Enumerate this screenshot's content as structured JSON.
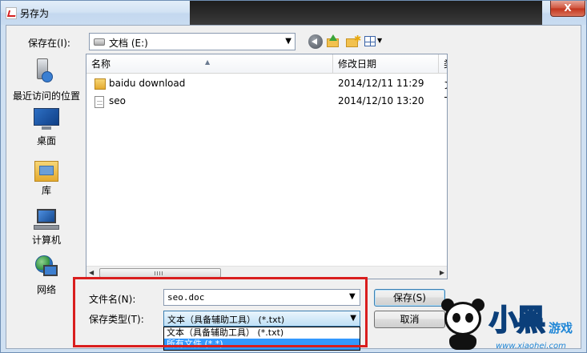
{
  "window": {
    "title": "另存为",
    "close_glyph": "X"
  },
  "toolbar": {
    "save_in_label": "保存在(I):",
    "save_in_value": "文档  (E:)",
    "back_icon": "back-arrow-icon",
    "up_icon": "up-folder-icon",
    "new_folder_icon": "new-folder-icon",
    "views_icon": "views-menu-icon"
  },
  "places": [
    {
      "label": "最近访问的位置",
      "icon": "recent-places-icon"
    },
    {
      "label": "桌面",
      "icon": "desktop-icon"
    },
    {
      "label": "库",
      "icon": "libraries-icon"
    },
    {
      "label": "计算机",
      "icon": "computer-icon"
    },
    {
      "label": "网络",
      "icon": "network-icon"
    }
  ],
  "filelist": {
    "columns": [
      "名称",
      "修改日期",
      "类"
    ],
    "rows": [
      {
        "name": "baidu download",
        "date": "2014/12/11 11:29",
        "extra": "文",
        "type": "folder"
      },
      {
        "name": "seo",
        "date": "2014/12/10 13:20",
        "extra": "T",
        "type": "document"
      }
    ]
  },
  "form": {
    "filename_label": "文件名(N):",
    "filename_value": "seo.doc",
    "filetype_label": "保存类型(T):",
    "filetype_value": "文本（具备辅助工具） (*.txt)",
    "filetype_options": [
      "文本（具备辅助工具） (*.txt)",
      "所有文件 (*.*)"
    ],
    "save_button": "保存(S)",
    "cancel_button": "取消"
  },
  "watermark": {
    "title": "小黑",
    "sub": "游戏",
    "url": "www.xiaohei.com"
  },
  "colors": {
    "highlight": "#d91e1e",
    "selection": "#3399ff",
    "accent": "#3c7fb1"
  }
}
